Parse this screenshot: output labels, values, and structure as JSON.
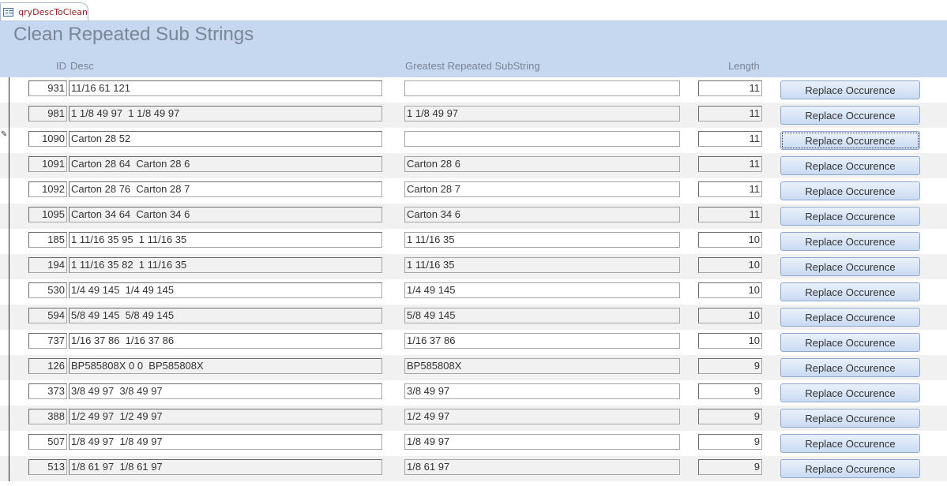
{
  "tab": {
    "label": "qryDescToClean",
    "icon": "query-table-icon"
  },
  "form": {
    "title": "Clean Repeated Sub Strings",
    "columns": {
      "id": "ID",
      "desc": "Desc",
      "substring": "Greatest Repeated SubString",
      "length": "Length"
    },
    "button_label": "Replace Occurence"
  },
  "rows": [
    {
      "id": "931",
      "desc": "11/16 61 121",
      "substring": "",
      "length": "11"
    },
    {
      "id": "981",
      "desc": "1 1/8 49 97  1 1/8 49 97",
      "substring": "1 1/8 49 97",
      "length": "11"
    },
    {
      "id": "1090",
      "desc": "Carton 28 52",
      "substring": "",
      "length": "11",
      "editing": true,
      "focused": true
    },
    {
      "id": "1091",
      "desc": "Carton 28 64  Carton 28 6",
      "substring": "Carton 28 6",
      "length": "11"
    },
    {
      "id": "1092",
      "desc": "Carton 28 76  Carton 28 7",
      "substring": "Carton 28 7",
      "length": "11"
    },
    {
      "id": "1095",
      "desc": "Carton 34 64  Carton 34 6",
      "substring": "Carton 34 6",
      "length": "11"
    },
    {
      "id": "185",
      "desc": "1 11/16 35 95  1 11/16 35",
      "substring": "1 11/16 35",
      "length": "10"
    },
    {
      "id": "194",
      "desc": "1 11/16 35 82  1 11/16 35",
      "substring": "1 11/16 35",
      "length": "10"
    },
    {
      "id": "530",
      "desc": "1/4 49 145  1/4 49 145",
      "substring": "1/4 49 145",
      "length": "10"
    },
    {
      "id": "594",
      "desc": "5/8 49 145  5/8 49 145",
      "substring": "5/8 49 145",
      "length": "10"
    },
    {
      "id": "737",
      "desc": "1/16 37 86  1/16 37 86",
      "substring": "1/16 37 86",
      "length": "10"
    },
    {
      "id": "126",
      "desc": "BP585808X 0 0  BP585808X",
      "substring": "BP585808X",
      "length": "9"
    },
    {
      "id": "373",
      "desc": "3/8 49 97  3/8 49 97",
      "substring": "3/8 49 97",
      "length": "9"
    },
    {
      "id": "388",
      "desc": "1/2 49 97  1/2 49 97",
      "substring": "1/2 49 97",
      "length": "9"
    },
    {
      "id": "507",
      "desc": "1/8 49 97  1/8 49 97",
      "substring": "1/8 49 97",
      "length": "9"
    },
    {
      "id": "513",
      "desc": "1/8 61 97  1/8 61 97",
      "substring": "1/8 61 97",
      "length": "9"
    }
  ],
  "colors": {
    "header_bg": "#c6d8ef",
    "alt_row_bg": "#f1f1f1",
    "tab_text": "#9b1c1c",
    "label_text": "#7a8595"
  }
}
